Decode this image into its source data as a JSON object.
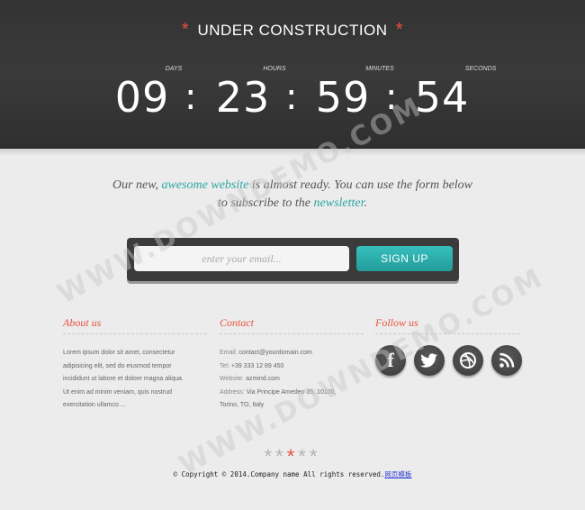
{
  "header": {
    "title": "UNDER CONSTRUCTION",
    "star": "*"
  },
  "countdown": {
    "labels": [
      "DAYS",
      "HOURS",
      "MINUTES",
      "SECONDS"
    ],
    "values": [
      "09",
      "23",
      "59",
      "54"
    ],
    "separator": ":"
  },
  "intro": {
    "line1_pre": "Our new, ",
    "line1_highlight": "awesome website",
    "line1_post": " is almost ready. You can use the form below",
    "line2_pre": "to subscribe to the ",
    "line2_highlight": "newsletter",
    "line2_post": "."
  },
  "form": {
    "email_placeholder": "enter your email...",
    "email_value": "",
    "signup_label": "SIGN UP"
  },
  "about": {
    "title": "About us",
    "lines": [
      "Lorem ipsum dolor sit amet, consectetur",
      "adipisicing elit, sed do eiusmod tempor",
      "incididunt ut labore et dolore magna aliqua.",
      "Ut enim ad minim veniam, quis nostrud",
      "exercitation ullamco ..."
    ]
  },
  "contact": {
    "title": "Contact",
    "email_label": "Email:",
    "email": "contact@yourdomain.com",
    "tel_label": "Tel:",
    "tel": "+39 333 12 89 450",
    "website_label": "Website:",
    "website": "azmind.com",
    "address_label": "Address:",
    "address_line1": "Via Principe Amedeo 35, 10100,",
    "address_line2": "Torino, TO, Italy"
  },
  "follow": {
    "title": "Follow us",
    "icons": [
      "facebook-icon",
      "twitter-icon",
      "dribbble-icon",
      "rss-icon"
    ],
    "facebook_glyph": "f"
  },
  "footer": {
    "stars": [
      "*",
      "*",
      "*",
      "*",
      "*"
    ],
    "copyright": "© Copyright © 2014.Company name All rights reserved.",
    "link": "网页模板"
  },
  "watermark": "WWW.DOWNDEMO.COM",
  "colors": {
    "accent_red": "#e9533e",
    "accent_teal": "#2aa7a3",
    "header_bg": "#333333"
  }
}
